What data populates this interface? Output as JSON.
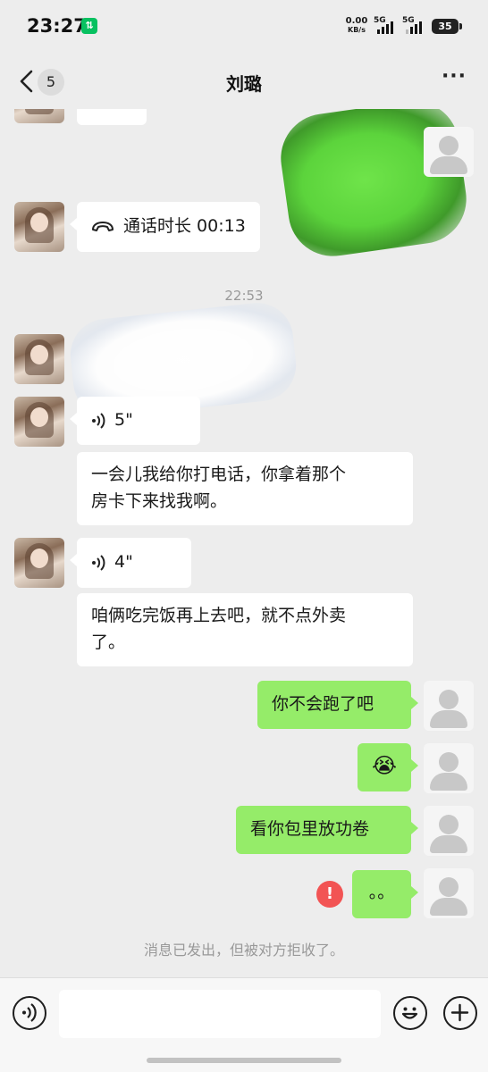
{
  "status_bar": {
    "time": "23:27",
    "net_speed_value": "0.00",
    "net_speed_unit": "KB/s",
    "signal1_label": "5G",
    "signal2_label": "5G",
    "battery_level": "35"
  },
  "header": {
    "unread_count": "5",
    "title": "刘璐",
    "more_label": "···"
  },
  "messages": [
    {
      "side": "left",
      "type": "call",
      "text": "通话时长 00:13"
    },
    {
      "side": "center",
      "type": "timestamp",
      "text": "22:53"
    },
    {
      "side": "left",
      "type": "voice",
      "duration": "5\""
    },
    {
      "side": "left",
      "type": "text",
      "text": "一会儿我给你打电话，你拿着那个房卡下来找我啊。"
    },
    {
      "side": "left",
      "type": "voice",
      "duration": "4\""
    },
    {
      "side": "left",
      "type": "text",
      "text": "咱俩吃完饭再上去吧，就不点外卖了。"
    },
    {
      "side": "right",
      "type": "text",
      "text": "你不会跑了吧"
    },
    {
      "side": "right",
      "type": "emoji",
      "text": "😭"
    },
    {
      "side": "right",
      "type": "text",
      "text": "看你包里放功卷"
    },
    {
      "side": "right",
      "type": "text",
      "text": "。。",
      "error": true
    }
  ],
  "text_lines": {
    "msg4_line1": "一会儿我给你打电话，你拿着那个",
    "msg4_line2": "房卡下来找我啊。",
    "msg6_line1": "咱俩吃完饭再上去吧，就不点外卖",
    "msg6_line2": "了。"
  },
  "system_note": "消息已发出，但被对方拒收了。",
  "error_mark": "!",
  "input": {
    "placeholder": "",
    "value": ""
  },
  "icons": {
    "back": "chevron-left-icon",
    "more": "more-dots-icon",
    "call": "phone-handset-icon",
    "voice": "voice-wave-icon",
    "voice_input": "voice-input-icon",
    "emoji": "emoji-face-icon",
    "plus": "plus-icon"
  },
  "colors": {
    "background": "#ededed",
    "bubble_right": "#95ec69",
    "bubble_left": "#ffffff",
    "error": "#f25454",
    "wechat_green": "#07c160"
  }
}
